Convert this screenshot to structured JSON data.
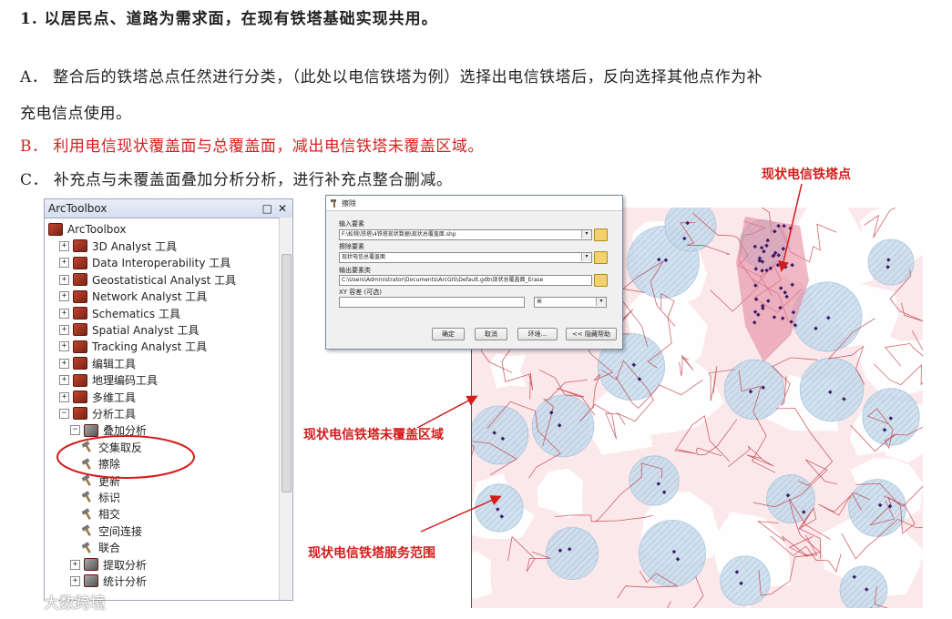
{
  "doc": {
    "heading": "1. 以居民点、道路为需求面，在现有铁塔基础实现共用。",
    "para_a": "A． 整合后的铁塔总点任然进行分类，（此处以电信铁塔为例）选择出电信铁塔后，反向选择其他点作为补",
    "para_a2": "充电信点使用。",
    "para_b": "B． 利用电信现状覆盖面与总覆盖面，减出电信铁塔未覆盖区域。",
    "para_c": "C． 补充点与未覆盖面叠加分析分析，进行补充点整合删减。"
  },
  "toolbox": {
    "title": "ArcToolbox",
    "ctrl_pin": "□",
    "ctrl_close": "✕",
    "items": [
      {
        "label": "ArcToolbox",
        "expander": "",
        "icon": "toolbox-icon"
      },
      {
        "label": "3D Analyst 工具",
        "expander": "+",
        "icon": "toolbox-icon"
      },
      {
        "label": "Data Interoperability 工具",
        "expander": "+",
        "icon": "toolbox-icon"
      },
      {
        "label": "Geostatistical Analyst 工具",
        "expander": "+",
        "icon": "toolbox-icon"
      },
      {
        "label": "Network Analyst 工具",
        "expander": "+",
        "icon": "toolbox-icon"
      },
      {
        "label": "Schematics 工具",
        "expander": "+",
        "icon": "toolbox-icon"
      },
      {
        "label": "Spatial Analyst 工具",
        "expander": "+",
        "icon": "toolbox-icon"
      },
      {
        "label": "Tracking Analyst 工具",
        "expander": "+",
        "icon": "toolbox-icon"
      },
      {
        "label": "编辑工具",
        "expander": "+",
        "icon": "toolbox-icon"
      },
      {
        "label": "地理编码工具",
        "expander": "+",
        "icon": "toolbox-icon"
      },
      {
        "label": "多维工具",
        "expander": "+",
        "icon": "toolbox-icon"
      },
      {
        "label": "分析工具",
        "expander": "−",
        "icon": "toolbox-icon"
      },
      {
        "label": "叠加分析",
        "expander": "−",
        "icon": "toolset-icon"
      },
      {
        "label": "交集取反",
        "expander": "",
        "icon": "hammer-icon"
      },
      {
        "label": "擦除",
        "expander": "",
        "icon": "hammer-icon"
      },
      {
        "label": "更新",
        "expander": "",
        "icon": "hammer-icon"
      },
      {
        "label": "标识",
        "expander": "",
        "icon": "hammer-icon"
      },
      {
        "label": "相交",
        "expander": "",
        "icon": "hammer-icon"
      },
      {
        "label": "空间连接",
        "expander": "",
        "icon": "hammer-icon"
      },
      {
        "label": "联合",
        "expander": "",
        "icon": "hammer-icon"
      },
      {
        "label": "提取分析",
        "expander": "+",
        "icon": "toolset-icon"
      },
      {
        "label": "统计分析",
        "expander": "+",
        "icon": "toolset-icon"
      }
    ]
  },
  "dialog": {
    "title": "擦除",
    "input_label": "输入要素",
    "input_value": "F:\\松桃\\铁塔\\4铁塔现状数据\\现状总覆盖面.shp",
    "erase_label": "擦除要素",
    "erase_value": "现状电信总覆盖面",
    "output_label": "输出要素类",
    "output_value": "C:\\Users\\Administrator\\Documents\\ArcGIS\\Default.gdb\\现状总覆盖面_Erase",
    "xy_label": "XY 容差 (可选)",
    "xy_value": "",
    "unit_value": "米",
    "btn_ok": "确定",
    "btn_cancel": "取消",
    "btn_env": "环境...",
    "btn_help": "<< 隐藏帮助"
  },
  "annotations": {
    "towers": "现状电信铁塔点",
    "uncovered": "现状电信铁塔未覆盖区域",
    "service": "现状电信铁塔服务范围"
  },
  "watermark": "大数跨境",
  "colors": {
    "annotation": "#d41c1c",
    "coverage": "#f4a9b0",
    "buffer": "#b9d3e8",
    "tower": "#3a1a6b"
  }
}
